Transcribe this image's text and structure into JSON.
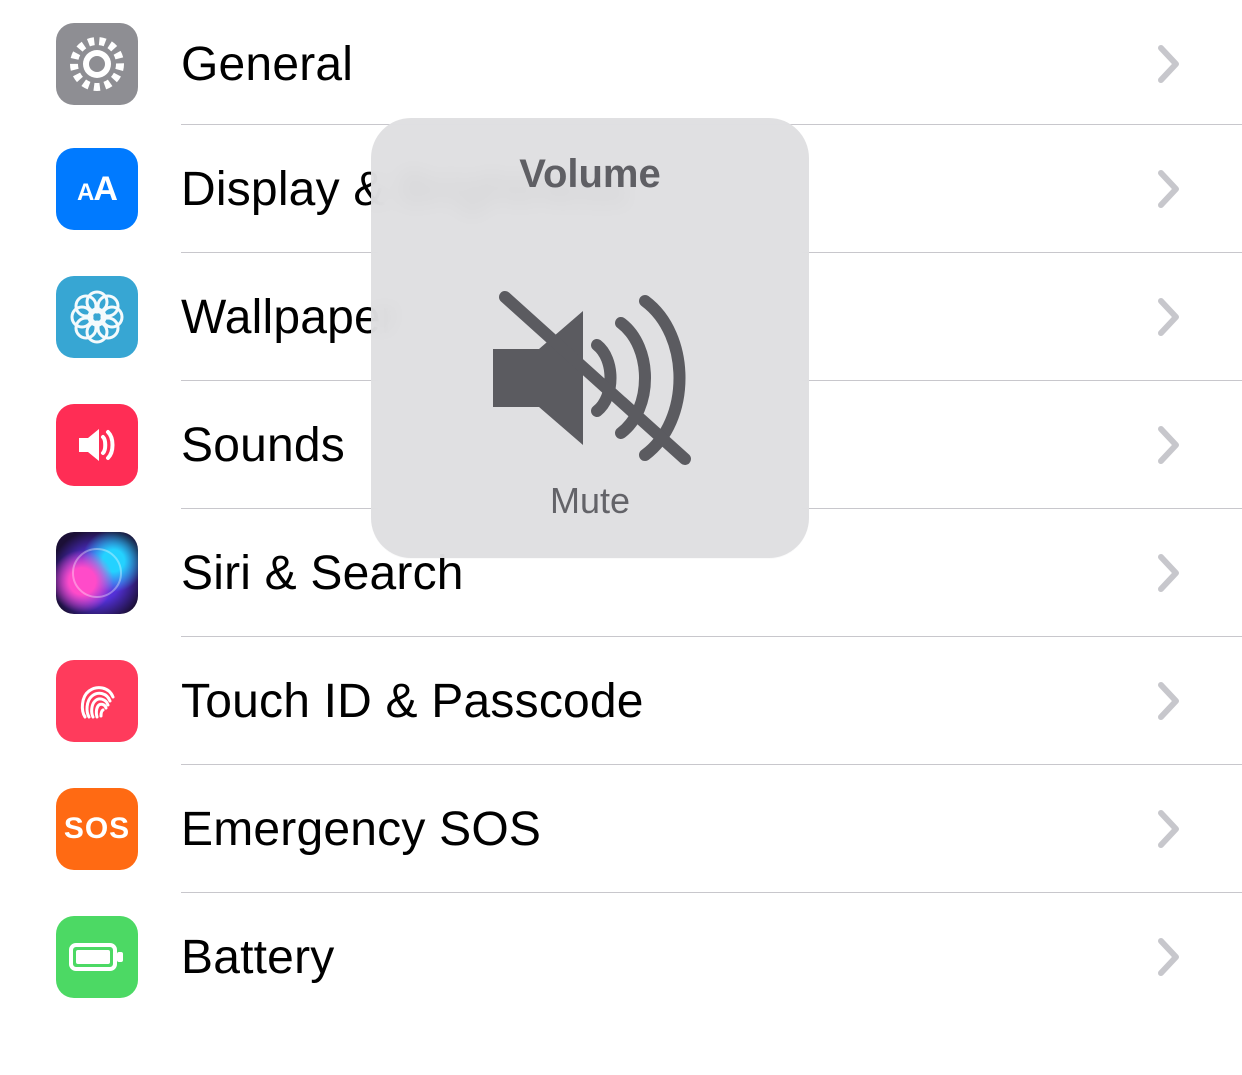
{
  "settings": {
    "items": [
      {
        "label": "General"
      },
      {
        "label": "Display & Brightness"
      },
      {
        "label": "Wallpaper"
      },
      {
        "label": "Sounds"
      },
      {
        "label": "Siri & Search"
      },
      {
        "label": "Touch ID & Passcode"
      },
      {
        "label": "Emergency SOS"
      },
      {
        "label": "Battery"
      }
    ],
    "sos_icon_text": "SOS"
  },
  "hud": {
    "title": "Volume",
    "subtitle": "Mute"
  }
}
